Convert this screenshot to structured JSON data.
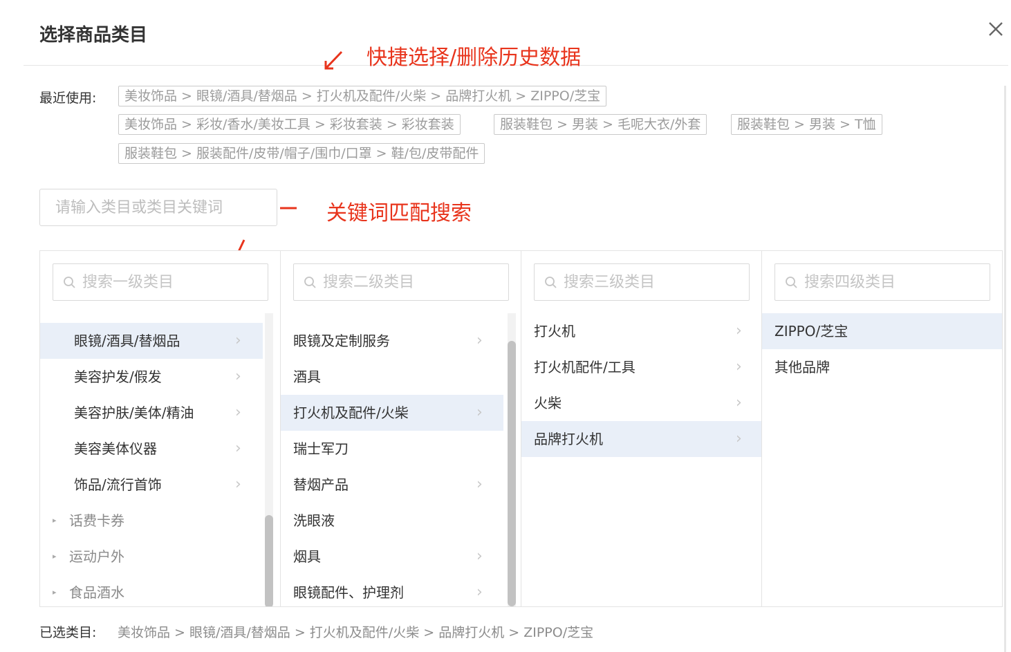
{
  "dialog": {
    "title": "选择商品类目"
  },
  "annotations": {
    "quick_select": "快捷选择/删除历史数据",
    "keyword_search": "关键词匹配搜索"
  },
  "recent": {
    "label": "最近使用:",
    "tags": [
      "美妆饰品 > 眼镜/酒具/替烟品 > 打火机及配件/火柴 > 品牌打火机 > ZIPPO/芝宝",
      "美妆饰品 > 彩妆/香水/美妆工具 > 彩妆套装 > 彩妆套装",
      "服装鞋包 > 男装 > 毛呢大衣/外套",
      "服装鞋包 > 男装 > T恤",
      "服装鞋包 > 服装配件/皮带/帽子/围巾/口罩 > 鞋/包/皮带配件"
    ]
  },
  "search": {
    "placeholder": "请输入类目或类目关键词"
  },
  "columns": [
    {
      "placeholder": "搜索一级类目",
      "items": [
        {
          "label": "眼镜/酒具/替烟品",
          "arrow": "›",
          "selected": true
        },
        {
          "label": "美容护发/假发",
          "arrow": "›"
        },
        {
          "label": "美容护肤/美体/精油",
          "arrow": "›"
        },
        {
          "label": "美容美体仪器",
          "arrow": "›"
        },
        {
          "label": "饰品/流行首饰",
          "arrow": "›"
        },
        {
          "label": "话费卡券",
          "collapsed": "▸"
        },
        {
          "label": "运动户外",
          "collapsed": "▸"
        },
        {
          "label": "食品酒水",
          "collapsed": "▸"
        }
      ]
    },
    {
      "placeholder": "搜索二级类目",
      "items": [
        {
          "label": "眼镜及定制服务",
          "arrow": "›"
        },
        {
          "label": "酒具"
        },
        {
          "label": "打火机及配件/火柴",
          "arrow": "›",
          "selected": true
        },
        {
          "label": "瑞士军刀"
        },
        {
          "label": "替烟产品",
          "arrow": "›"
        },
        {
          "label": "洗眼液"
        },
        {
          "label": "烟具",
          "arrow": "›"
        },
        {
          "label": "眼镜配件、护理剂",
          "arrow": "›"
        }
      ]
    },
    {
      "placeholder": "搜索三级类目",
      "items": [
        {
          "label": "打火机",
          "arrow": "›"
        },
        {
          "label": "打火机配件/工具",
          "arrow": "›"
        },
        {
          "label": "火柴",
          "arrow": "›"
        },
        {
          "label": "品牌打火机",
          "arrow": "›",
          "selected": true
        }
      ]
    },
    {
      "placeholder": "搜索四级类目",
      "items": [
        {
          "label": "ZIPPO/芝宝",
          "selected": true
        },
        {
          "label": "其他品牌"
        }
      ]
    }
  ],
  "selected": {
    "label": "已选类目:",
    "path": "美妆饰品 > 眼镜/酒具/替烟品 > 打火机及配件/火柴 > 品牌打火机 > ZIPPO/芝宝"
  },
  "colors": {
    "annotation": "#e8341c",
    "selected_row": "#e9eff8"
  }
}
